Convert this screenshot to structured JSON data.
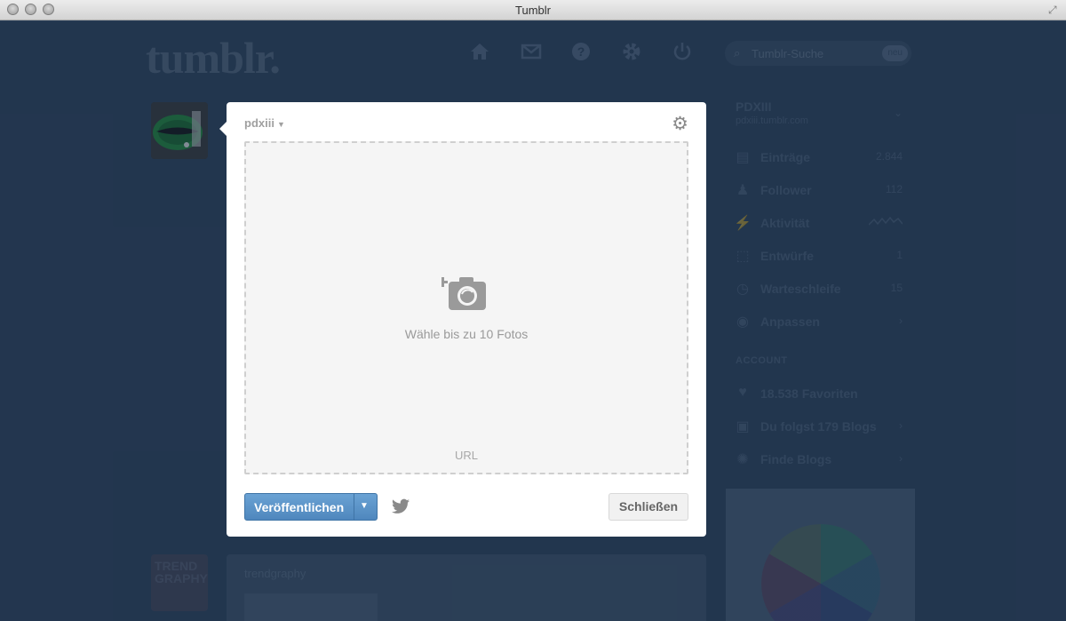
{
  "window": {
    "title": "Tumblr"
  },
  "header": {
    "logo": "tumblr.",
    "search": {
      "placeholder": "Tumblr-Suche",
      "badge": "neu"
    }
  },
  "dialog": {
    "blog_name": "pdxiii",
    "drop_label": "Wähle bis zu 10 Fotos",
    "url_label": "URL",
    "publish_label": "Veröffentlichen",
    "close_label": "Schließen"
  },
  "sidebar": {
    "blog_title": "PDXIII",
    "blog_subtitle": "pdxiii.tumblr.com",
    "items": [
      {
        "label": "Einträge",
        "value": "2.844",
        "icon": "posts-icon"
      },
      {
        "label": "Follower",
        "value": "112",
        "icon": "followers-icon"
      },
      {
        "label": "Aktivität",
        "value": "",
        "icon": "activity-icon"
      },
      {
        "label": "Entwürfe",
        "value": "1",
        "icon": "drafts-icon"
      },
      {
        "label": "Warteschleife",
        "value": "15",
        "icon": "queue-icon"
      },
      {
        "label": "Anpassen",
        "value": "",
        "icon": "customize-icon"
      }
    ],
    "account_header": "ACCOUNT",
    "account_items": [
      {
        "label": "18.538 Favoriten",
        "icon": "heart-icon"
      },
      {
        "label": "Du folgst 179 Blogs",
        "icon": "following-icon"
      },
      {
        "label": "Finde Blogs",
        "icon": "find-blogs-icon"
      }
    ]
  },
  "background_post": {
    "blog_name": "trendgraphy",
    "avatar_text": "TREND GRAPHY"
  }
}
